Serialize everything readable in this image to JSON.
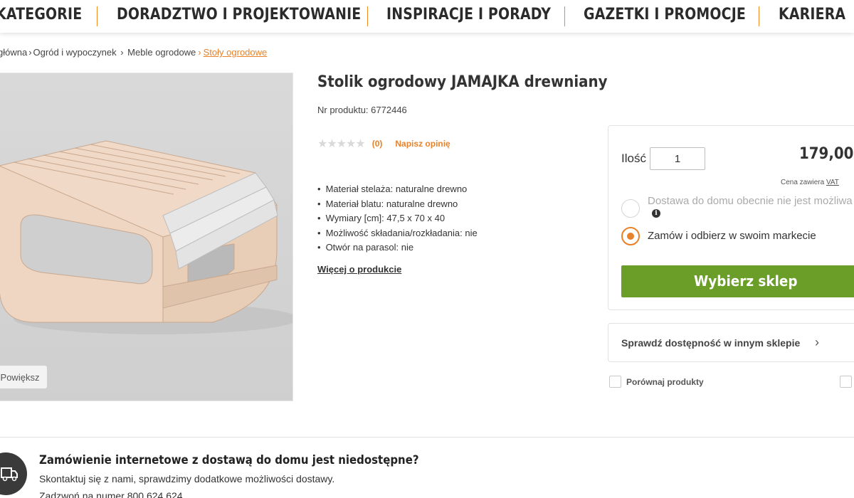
{
  "nav": {
    "items": [
      "KATEGORIE",
      "DORADZTWO I PROJEKTOWANIE",
      "INSPIRACJE I PORADY",
      "GAZETKI I PROMOCJE",
      "KARIERA"
    ]
  },
  "breadcrumb": {
    "items": [
      "główna",
      "Ogród i wypoczynek",
      "Meble ogrodowe"
    ],
    "current": "Stoły ogrodowe"
  },
  "image": {
    "zoom_label": "Powiększ"
  },
  "product": {
    "title": "Stolik ogrodowy JAMAJKA drewniany",
    "sku_label": "Nr produktu:",
    "sku": "6772446",
    "rating_count": "(0)",
    "write_review": "Napisz opinię",
    "features": [
      "Materiał stelaża: naturalne drewno",
      "Materiał blatu: naturalne drewno",
      "Wymiary [cm]: 47,5 x 70 x 40",
      "Możliwość składania/rozkładania: nie",
      "Otwór na parasol: nie"
    ],
    "more_link": "Więcej o produkcie"
  },
  "buybox": {
    "qty_label": "Ilość",
    "qty_value": "1",
    "price": "179,00",
    "vat_note": "Cena zawiera",
    "vat_link": "VAT",
    "option_home": "Dostawa do domu obecnie nie jest możliwa",
    "option_store": "Zamów i odbierz w swoim markecie",
    "choose_store": "Wybierz sklep",
    "check_availability": "Sprawdź dostępność w innym sklepie",
    "compare": "Porównaj produkty"
  },
  "delivery": {
    "title": "Zamówienie internetowe z dostawą do domu jest niedostępne?",
    "text": "Skontaktuj się z nami, sprawdzimy dodatkowe możliwości dostawy.",
    "phone": "Zadzwoń na numer 800 624 624"
  },
  "colors": {
    "accent": "#e8822a",
    "button_green": "#6a9e28"
  }
}
